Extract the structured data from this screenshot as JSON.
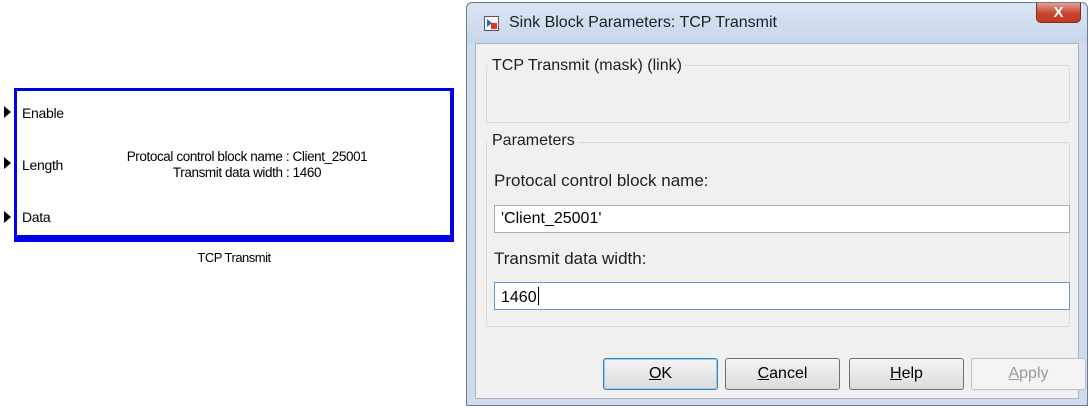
{
  "block": {
    "ports": [
      {
        "label": "Enable"
      },
      {
        "label": "Length"
      },
      {
        "label": "Data"
      }
    ],
    "info_line1": "Protocal control block name : Client_25001",
    "info_line2": "Transmit data width : 1460",
    "name": "TCP Transmit",
    "border_color": "#0000e6"
  },
  "dialog": {
    "title": "Sink Block Parameters: TCP Transmit",
    "close_label": "X",
    "app_icon": "simulink-icon",
    "mask_group_title": "TCP Transmit (mask) (link)",
    "parameters_group_title": "Parameters",
    "field1_label": "Protocal control block name:",
    "field1_value": "'Client_25001'",
    "field2_label": "Transmit data width:",
    "field2_value": "1460",
    "buttons": {
      "ok_mnemonic": "O",
      "ok_rest": "K",
      "cancel_mnemonic": "C",
      "cancel_rest": "ancel",
      "help_mnemonic": "H",
      "help_rest": "elp",
      "apply_mnemonic": "A",
      "apply_rest": "pply"
    }
  }
}
